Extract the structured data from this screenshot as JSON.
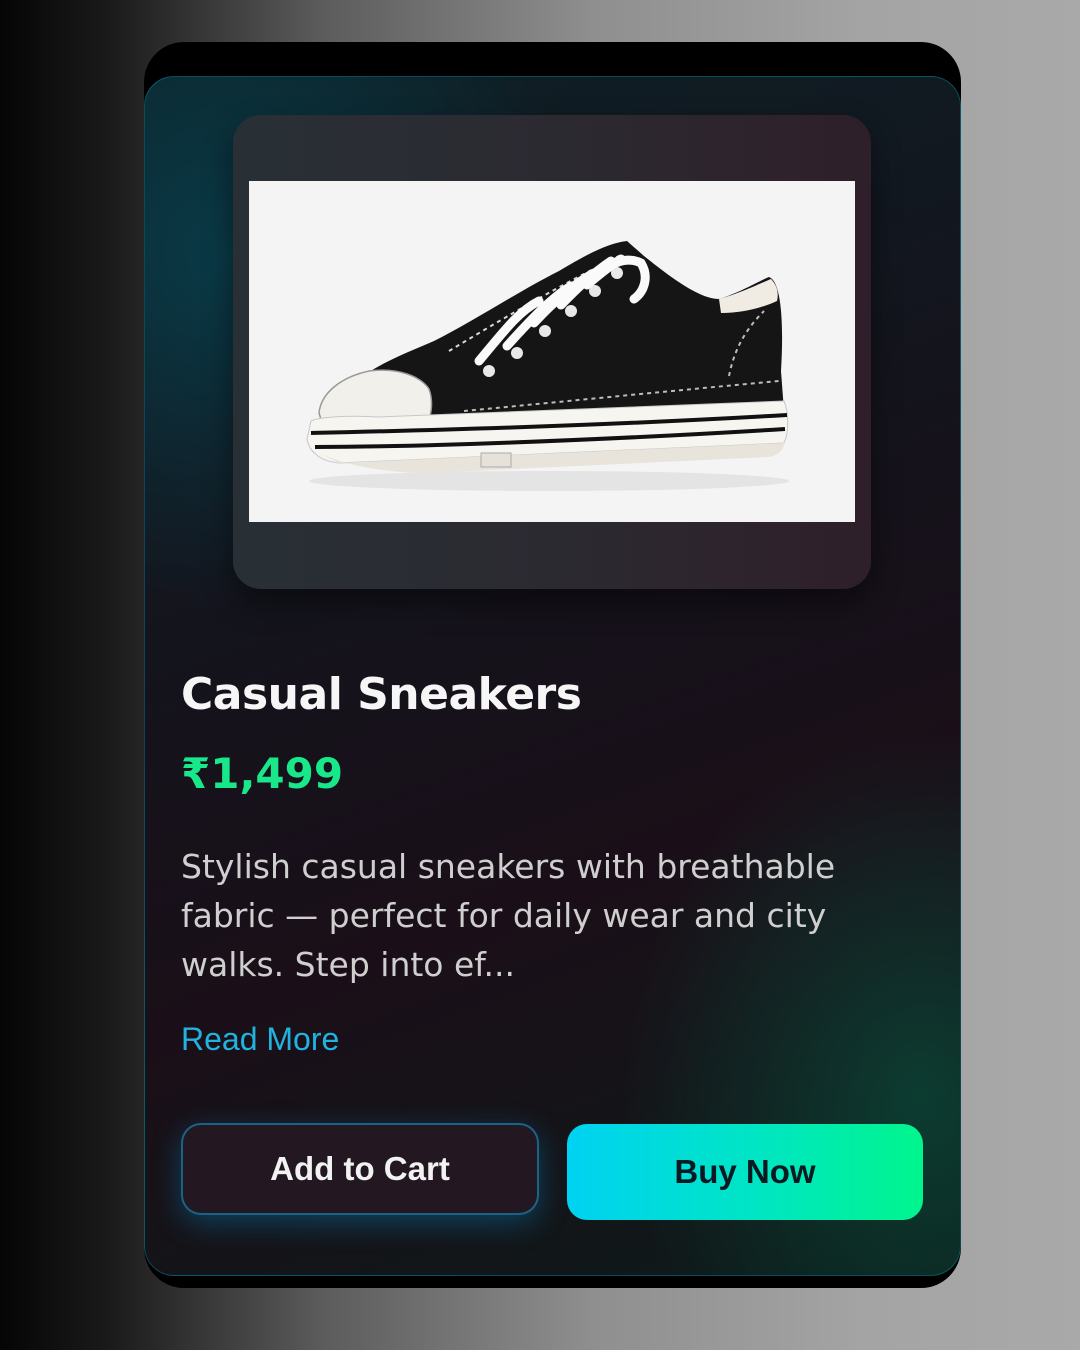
{
  "product": {
    "name": "Casual Sneakers",
    "price": "₹1,499",
    "description": "Stylish casual sneakers with breathable fabric — perfect for daily wear and city walks. Step into ef...",
    "read_more": "Read More",
    "image_icon": "sneaker-image"
  },
  "actions": {
    "add_to_cart": "Add to Cart",
    "buy_now": "Buy Now"
  },
  "colors": {
    "price": "#19e88a",
    "link": "#20b3e0",
    "buy_gradient_start": "#00d2f2",
    "buy_gradient_end": "#00f58c"
  }
}
